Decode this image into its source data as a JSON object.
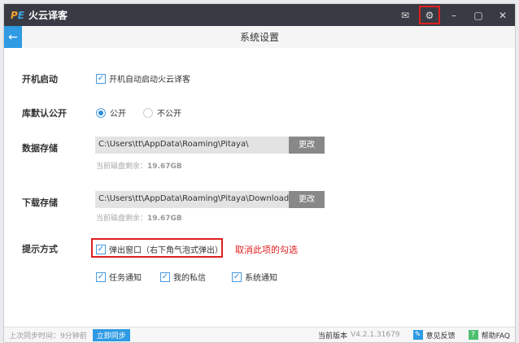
{
  "app": {
    "logo": "PE",
    "name": "火云译客"
  },
  "header": {
    "title": "系统设置"
  },
  "settings": {
    "startup": {
      "label": "开机启动",
      "option": "开机自动启动火云译客",
      "checked": true
    },
    "library": {
      "label": "库默认公开",
      "options": [
        "公开",
        "不公开"
      ],
      "selected": "公开"
    },
    "data_storage": {
      "label": "数据存储",
      "path": "C:\\Users\\tt\\AppData\\Roaming\\Pitaya\\",
      "button": "更改",
      "free_label": "当前磁盘剩余：",
      "free": "19.67GB"
    },
    "download_storage": {
      "label": "下载存储",
      "path": "C:\\Users\\tt\\AppData\\Roaming\\Pitaya\\Downloads",
      "button": "更改",
      "free_label": "当前磁盘剩余：",
      "free": "19.67GB"
    },
    "notify": {
      "label": "提示方式",
      "popup": "弹出窗口（右下角气泡式弹出）",
      "items": [
        "任务通知",
        "我的私信",
        "系统通知"
      ]
    }
  },
  "annotation": "取消此项的勾选",
  "footer": {
    "last_sync": "上次同步时间：9分钟前",
    "sync_button": "立即同步",
    "version_label": "当前版本",
    "version": "V4.2.1.31679",
    "feedback": "意见反馈",
    "help": "帮助FAQ"
  },
  "colors": {
    "accent": "#2e9be4",
    "highlight": "#e02020",
    "titlebar": "#383b43"
  }
}
